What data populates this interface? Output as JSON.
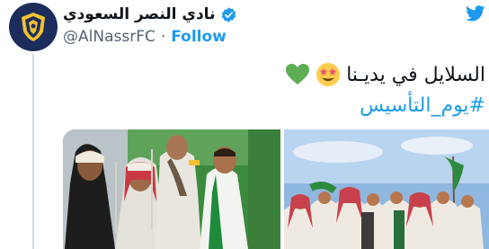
{
  "account": {
    "display_name": "نادي النصر السعودي",
    "handle": "@AlNassrFC",
    "separator": "·",
    "follow_label": "Follow"
  },
  "tweet": {
    "line1_text": "السلايل في يديـنا",
    "line1_emojis": [
      "star-struck-emoji",
      "green-heart-emoji"
    ],
    "hashtag": "#يوم_التأسيس"
  },
  "media": [
    {
      "name": "photo-players-traditional-dress"
    },
    {
      "name": "photo-group-flags-celebration"
    }
  ],
  "colors": {
    "accent": "#1d9bf0",
    "secondary_text": "#536471",
    "avatar_bg": "#1d2d5b",
    "club_gold": "#f2c230"
  }
}
